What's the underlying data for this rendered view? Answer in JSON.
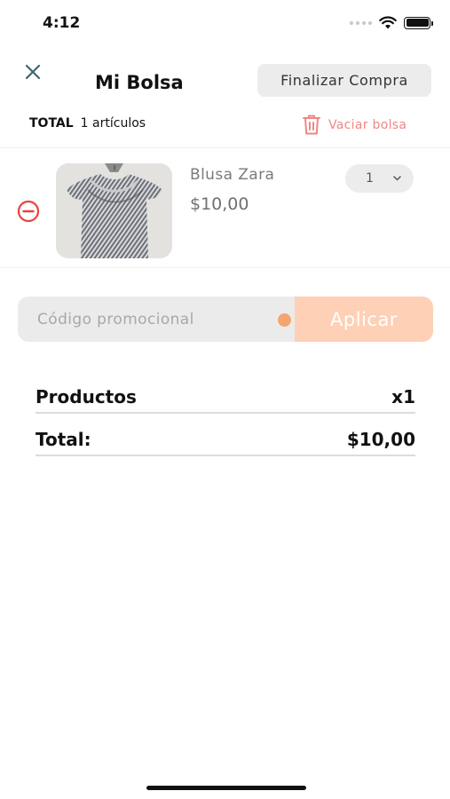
{
  "status_bar": {
    "time": "4:12"
  },
  "header": {
    "title": "Mi Bolsa",
    "checkout_label": "Finalizar Compra",
    "close_icon": "close-icon"
  },
  "bag_summary": {
    "total_label": "TOTAL",
    "items_count_text": "1 artículos",
    "empty_bag_label": "Vaciar bolsa",
    "empty_bag_icon": "trash-icon"
  },
  "cart": {
    "items": [
      {
        "name": "Blusa Zara",
        "price": "$10,00",
        "quantity": "1",
        "image_icon": "product-photo-blouse"
      }
    ]
  },
  "promo": {
    "placeholder": "Código promocional",
    "value": "",
    "apply_label": "Aplicar"
  },
  "summary": {
    "products_label": "Productos",
    "products_value": "x1",
    "total_label": "Total:",
    "total_value": "$10,00"
  },
  "colors": {
    "accent_red": "#f08686",
    "remove_red": "#e8423f",
    "apply_button": "#fed0b6",
    "close_icon": "#3f6670"
  }
}
